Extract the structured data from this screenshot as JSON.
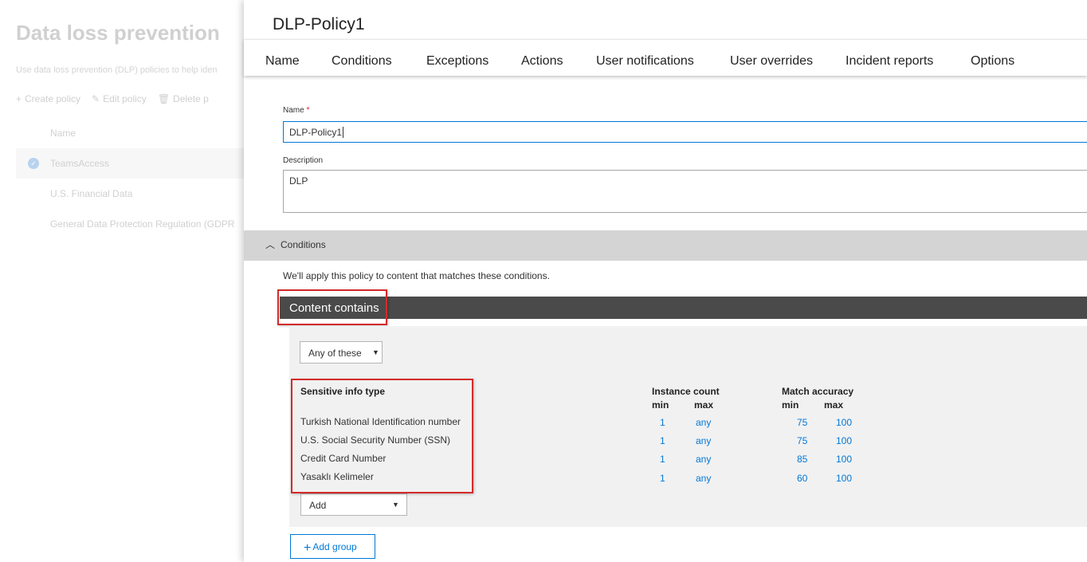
{
  "background": {
    "title": "Data loss prevention",
    "description": "Use data loss prevention (DLP) policies to help iden",
    "toolbar": {
      "create": "Create policy",
      "edit": "Edit policy",
      "delete": "Delete p"
    },
    "column_name": "Name",
    "policies": [
      {
        "name": "TeamsAccess",
        "selected": true
      },
      {
        "name": "U.S. Financial Data",
        "selected": false
      },
      {
        "name": "General Data Protection Regulation (GDPR",
        "selected": false
      }
    ]
  },
  "panel": {
    "title": "DLP-Policy1",
    "tabs": [
      "Name",
      "Conditions",
      "Exceptions",
      "Actions",
      "User notifications",
      "User overrides",
      "Incident reports",
      "Options"
    ],
    "name_label": "Name",
    "name_required_mark": "*",
    "name_value": "DLP-Policy1",
    "description_label": "Description",
    "description_value": "DLP",
    "conditions_section": {
      "label": "Conditions",
      "expanded": true,
      "note": "We'll apply this policy to content that matches these conditions.",
      "group_title": "Content contains",
      "match_mode": "Any of these",
      "table": {
        "col_type": "Sensitive info type",
        "col_instance": "Instance count",
        "col_accuracy": "Match accuracy",
        "sub_min": "min",
        "sub_max": "max",
        "rows": [
          {
            "type": "Turkish National Identification number",
            "inst_min": "1",
            "inst_max": "any",
            "acc_min": "75",
            "acc_max": "100"
          },
          {
            "type": "U.S. Social Security Number (SSN)",
            "inst_min": "1",
            "inst_max": "any",
            "acc_min": "75",
            "acc_max": "100"
          },
          {
            "type": "Credit Card Number",
            "inst_min": "1",
            "inst_max": "any",
            "acc_min": "85",
            "acc_max": "100"
          },
          {
            "type": "Yasaklı Kelimeler",
            "inst_min": "1",
            "inst_max": "any",
            "acc_min": "60",
            "acc_max": "100"
          }
        ]
      },
      "add_label": "Add",
      "add_group_label": "Add group"
    }
  },
  "colors": {
    "accent": "#0078d7",
    "highlight_box": "#d42b2b",
    "group_header": "#4a4a4a",
    "section_bar": "#d4d4d4"
  }
}
